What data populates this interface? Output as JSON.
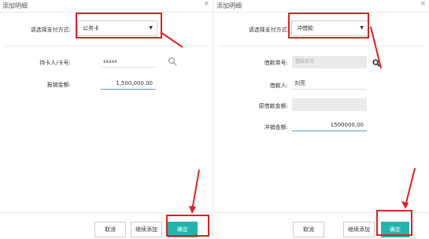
{
  "left": {
    "title": "添加明细",
    "pay_label": "请选择支付方式:",
    "pay_value": "公务卡",
    "card_label": "持卡人/卡号:",
    "card_value": "xxxxx",
    "amount_label": "报销金额:",
    "amount_value": "1,500,000.00",
    "buttons": {
      "cancel": "取消",
      "continue": "继续添加",
      "confirm": "确定"
    }
  },
  "right": {
    "title": "添加明细",
    "pay_label": "请选择支付方式:",
    "pay_value": "冲借款",
    "loan_no_label": "借款单号:",
    "loan_no_placeholder": "借款单号",
    "borrower_label": "借款人:",
    "borrower_value": "刘亮",
    "original_amount_label": "原借款金额:",
    "offset_amount_label": "冲销金额:",
    "offset_amount_value": "1500000,00",
    "buttons": {
      "cancel": "取消",
      "continue": "继续添加",
      "confirm": "确定"
    }
  },
  "colors": {
    "primary": "#1fb5ad",
    "annotation": "#e02020",
    "focus_underline": "#5b9bd5"
  },
  "icons": {
    "close": "close-icon",
    "search": "search-icon",
    "dropdown": "chevron-down-icon"
  }
}
